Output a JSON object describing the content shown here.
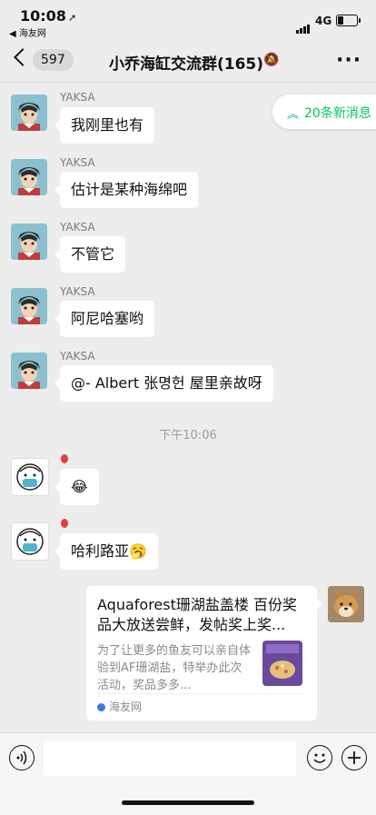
{
  "status": {
    "time": "10:08",
    "back_app": "◀ 海友网",
    "network": "4G"
  },
  "header": {
    "unread": "597",
    "title": "小乔海缸交流群(165)"
  },
  "new_messages": "20条新消息",
  "messages": [
    {
      "sender": "YAKSA",
      "text": "我刚里也有"
    },
    {
      "sender": "YAKSA",
      "text": "估计是某种海绵吧"
    },
    {
      "sender": "YAKSA",
      "text": "不管它"
    },
    {
      "sender": "YAKSA",
      "text": "阿尼哈塞哟"
    },
    {
      "sender": "YAKSA",
      "text": "@- Albert 张명헌 屋里亲故呀"
    }
  ],
  "timestamp": "下午10:06",
  "emoji_messages": [
    {
      "text": "😂"
    },
    {
      "text": "哈利路亚🥱"
    }
  ],
  "link_card": {
    "title": "Aquaforest珊湖盐盖楼 百份奖品大放送尝鲜，发帖奖上奖...",
    "description": "为了让更多的鱼友可以亲自体验到AF珊湖盐，特举办此次活动，奖品多多...",
    "source": "海友网"
  },
  "colors": {
    "accent": "#07c160",
    "background": "#ededed",
    "bubble": "#ffffff"
  }
}
